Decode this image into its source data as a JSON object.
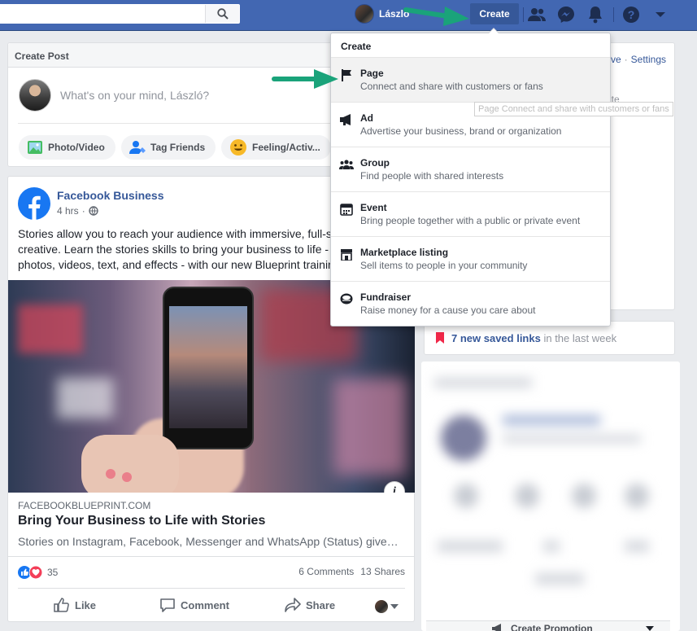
{
  "topbar": {
    "user_name": "László",
    "create_label": "Create",
    "colors": {
      "bar": "#4267b2",
      "create_bg": "#365899"
    },
    "icons": [
      "search-icon",
      "friends-icon",
      "messenger-icon",
      "notifications-icon",
      "help-icon",
      "account-menu-icon"
    ]
  },
  "create_post": {
    "header": "Create Post",
    "placeholder": "What's on your mind, László?",
    "chips": [
      {
        "label": "Photo/Video",
        "icon": "photo-icon"
      },
      {
        "label": "Tag Friends",
        "icon": "tag-friends-icon"
      },
      {
        "label": "Feeling/Activ...",
        "icon": "feeling-icon"
      }
    ]
  },
  "dropdown": {
    "header": "Create",
    "items": [
      {
        "title": "Page",
        "desc": "Connect and share with customers or fans",
        "icon": "flag-icon"
      },
      {
        "title": "Ad",
        "desc": "Advertise your business, brand or organization",
        "icon": "megaphone-icon"
      },
      {
        "title": "Group",
        "desc": "Find people with shared interests",
        "icon": "group-icon"
      },
      {
        "title": "Event",
        "desc": "Bring people together with a public or private event",
        "icon": "calendar-icon"
      },
      {
        "title": "Marketplace listing",
        "desc": "Sell items to people in your community",
        "icon": "shop-icon"
      },
      {
        "title": "Fundraiser",
        "desc": "Raise money for a cause you care about",
        "icon": "fundraiser-icon"
      }
    ],
    "tooltip": "Page Connect and share with customers or fans"
  },
  "right_col": {
    "partial_link": "ve",
    "settings": "Settings",
    "partial_text": "ite",
    "saved_links": "7 new saved links",
    "saved_suffix": "in the last week",
    "create_promotion": "Create Promotion"
  },
  "post": {
    "page_name": "Facebook Business",
    "time": "4 hrs",
    "body_lines": [
      "Stories allow you to reach your audience with immersive, full-s",
      "creative. Learn the stories skills to bring your business to life -",
      "photos, videos, text, and effects - with our new Blueprint trainin"
    ],
    "link_domain": "FACEBOOKBLUEPRINT.COM",
    "link_title": "Bring Your Business to Life with Stories",
    "link_desc": "Stories on Instagram, Facebook, Messenger and WhatsApp (Status) give…",
    "reaction_count": "35",
    "comments": "6 Comments",
    "shares": "13 Shares",
    "actions": {
      "like": "Like",
      "comment": "Comment",
      "share": "Share"
    }
  }
}
